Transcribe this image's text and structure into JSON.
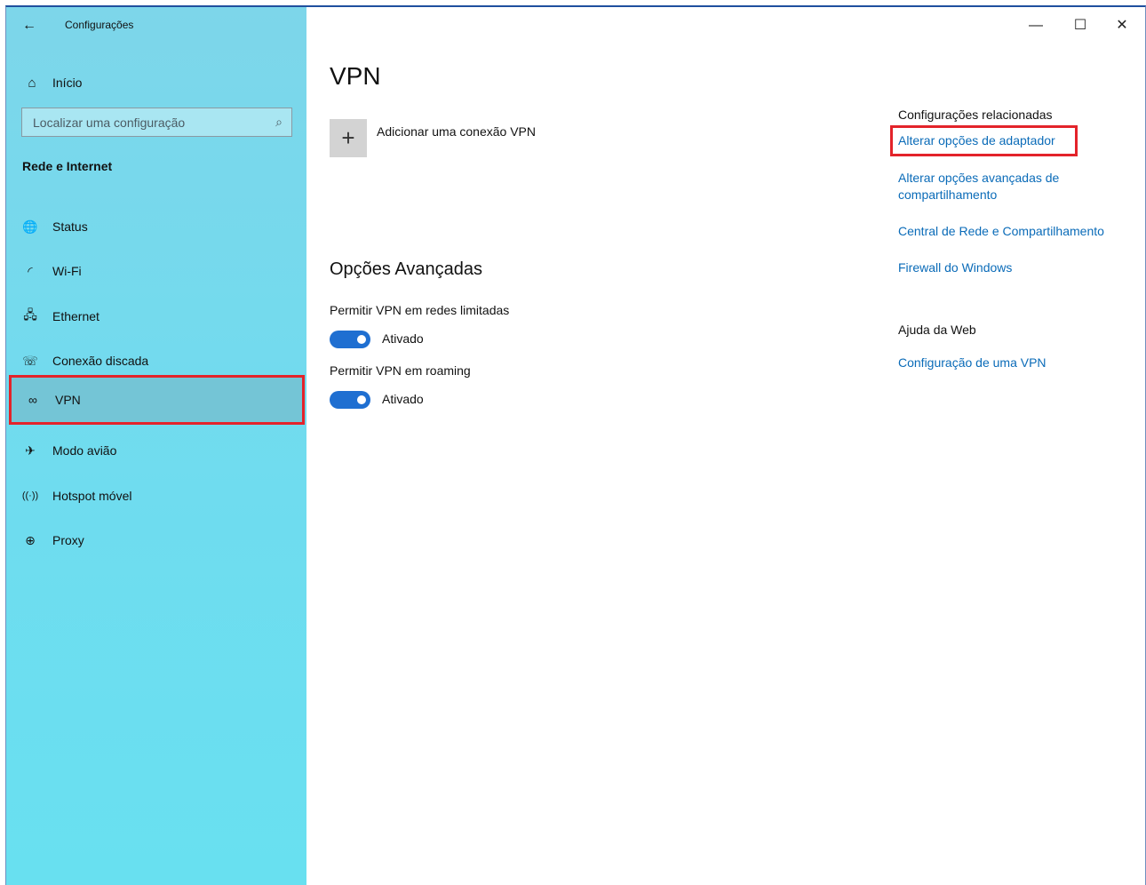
{
  "window": {
    "title": "Configurações"
  },
  "titlebar": {
    "back_icon": "←",
    "minimize_icon": "—",
    "maximize_icon": "☐",
    "close_icon": "✕"
  },
  "sidebar": {
    "home": {
      "icon": "⌂",
      "label": "Início"
    },
    "search": {
      "placeholder": "Localizar uma configuração",
      "value": "",
      "icon": "⌕"
    },
    "section_title": "Rede e Internet",
    "items": [
      {
        "icon": "🌐",
        "label": "Status"
      },
      {
        "icon": "◜",
        "label": "Wi-Fi"
      },
      {
        "icon": "🖧",
        "label": "Ethernet"
      },
      {
        "icon": "☏",
        "label": "Conexão discada"
      },
      {
        "icon": "∞",
        "label": "VPN",
        "selected": true
      },
      {
        "icon": "✈",
        "label": "Modo avião"
      },
      {
        "icon": "((·))",
        "label": "Hotspot móvel"
      },
      {
        "icon": "⊕",
        "label": "Proxy"
      }
    ]
  },
  "main": {
    "title": "VPN",
    "add_vpn": {
      "icon": "+",
      "label": "Adicionar uma conexão VPN"
    },
    "advanced": {
      "title": "Opções Avançadas",
      "settings": [
        {
          "label": "Permitir VPN em redes limitadas",
          "state": "Ativado",
          "on": true
        },
        {
          "label": "Permitir VPN em roaming",
          "state": "Ativado",
          "on": true
        }
      ]
    }
  },
  "related": {
    "heading": "Configurações relacionadas",
    "links": [
      "Alterar opções de adaptador",
      "Alterar opções avançadas de compartilhamento",
      "Central de Rede e Compartilhamento",
      "Firewall do Windows"
    ],
    "help_heading": "Ajuda da Web",
    "help_links": [
      "Configuração de uma VPN"
    ]
  },
  "colors": {
    "accent": "#1f6fd1",
    "link": "#0a6bb8",
    "highlight": "#e3232a",
    "sidebar": "#6fdcef"
  }
}
